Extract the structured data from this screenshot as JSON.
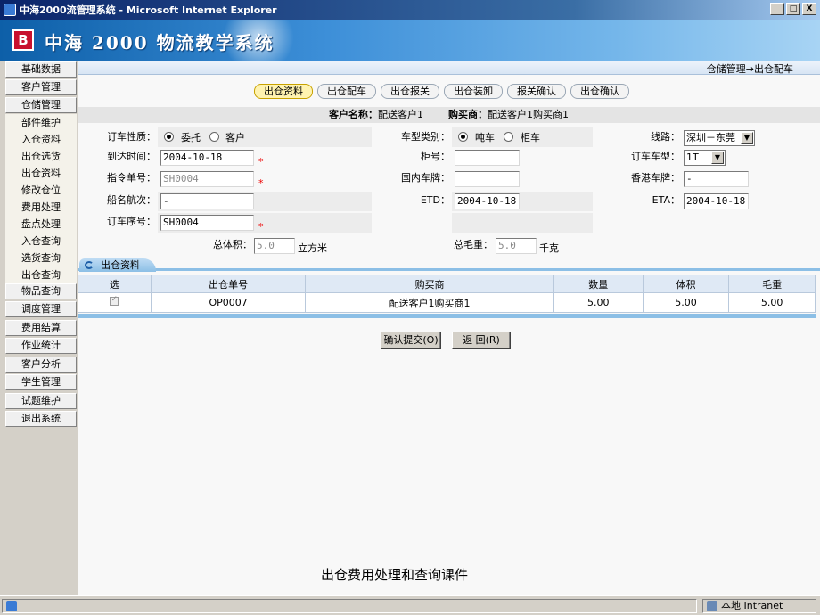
{
  "window": {
    "title": "中海2000流管理系统 - Microsoft Internet Explorer",
    "min": "_",
    "max": "□",
    "close": "X"
  },
  "banner": {
    "logo": "B",
    "title": "中海 2000 物流教学系统"
  },
  "sidebar": {
    "items": [
      {
        "label": "基础数据"
      },
      {
        "label": "客户管理"
      },
      {
        "label": "仓储管理"
      }
    ],
    "subitems": [
      {
        "label": "部件维护"
      },
      {
        "label": "入仓资料"
      },
      {
        "label": "出仓选货"
      },
      {
        "label": "出仓资料"
      },
      {
        "label": "修改仓位"
      },
      {
        "label": "费用处理"
      },
      {
        "label": "盘点处理"
      },
      {
        "label": "入仓查询"
      },
      {
        "label": "选货查询"
      },
      {
        "label": "出仓查询"
      }
    ],
    "items2": [
      {
        "label": "物品查询"
      },
      {
        "label": "调度管理"
      },
      {
        "label": "费用结算"
      },
      {
        "label": "作业统计"
      },
      {
        "label": "客户分析"
      },
      {
        "label": "学生管理"
      },
      {
        "label": "试题维护"
      },
      {
        "label": "退出系统"
      }
    ]
  },
  "breadcrumb": "仓储管理→出仓配车",
  "steps": [
    {
      "label": "出仓资料"
    },
    {
      "label": "出仓配车"
    },
    {
      "label": "出仓报关"
    },
    {
      "label": "出仓装卸"
    },
    {
      "label": "报关确认"
    },
    {
      "label": "出仓确认"
    }
  ],
  "customer": {
    "name_label": "客户名称：",
    "name_value": "配送客户1",
    "buyer_label": "购买商：",
    "buyer_value": "配送客户1购买商1"
  },
  "form": {
    "nature_label": "订车性质：",
    "nature_opt1": "委托",
    "nature_opt2": "客户",
    "arrival_label": "到达时间：",
    "arrival_value": "2004-10-18",
    "order_label": "指令单号：",
    "order_value": "SH0004",
    "ship_label": "船名航次：",
    "ship_value": "-",
    "seq_label": "订车序号：",
    "seq_value": "SH0004",
    "cartype_label": "车型类别：",
    "cartype_opt1": "吨车",
    "cartype_opt2": "柜车",
    "cabinet_label": "柜号：",
    "cabinet_value": "",
    "domestic_label": "国内车牌：",
    "domestic_value": "",
    "etd_label": "ETD：",
    "etd_value": "2004-10-18",
    "route_label": "线路：",
    "route_value": "深圳－东莞",
    "bookcar_label": "订车车型：",
    "bookcar_value": "1T",
    "hkplate_label": "香港车牌：",
    "hkplate_value": "-",
    "eta_label": "ETA：",
    "eta_value": "2004-10-18",
    "volume_label": "总体积：",
    "volume_value": "5.0",
    "volume_unit": "立方米",
    "weight_label": "总毛重：",
    "weight_value": "5.0",
    "weight_unit": "千克",
    "required_mark": "*"
  },
  "tab": {
    "label": "出仓资料"
  },
  "table": {
    "headers": [
      "选",
      "出仓单号",
      "购买商",
      "数量",
      "体积",
      "毛重"
    ],
    "rows": [
      {
        "order": "OP0007",
        "buyer": "配送客户1购买商1",
        "qty": "5.00",
        "volume": "5.00",
        "weight": "5.00"
      }
    ]
  },
  "buttons": {
    "submit": "确认提交(O)",
    "back": "返 回(R)"
  },
  "caption": "出仓费用处理和查询课件",
  "status": {
    "zone": "本地 Intranet"
  }
}
